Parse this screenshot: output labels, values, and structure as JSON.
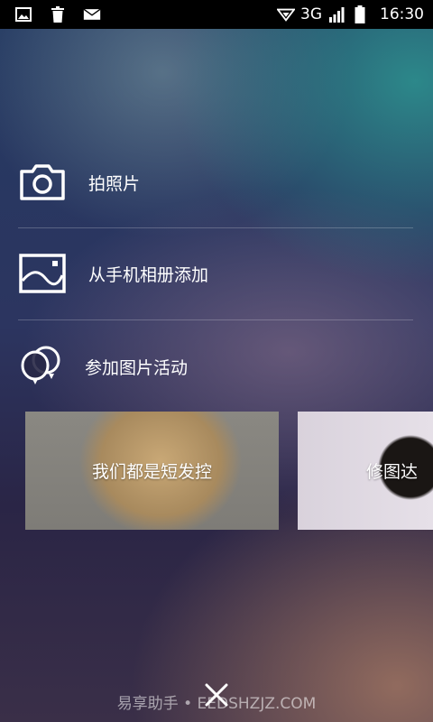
{
  "status_bar": {
    "network": "3G",
    "time": "16:30",
    "left_icons": [
      "image-icon",
      "trash-icon",
      "mail-icon"
    ],
    "right_icons": [
      "signal-hotspot-icon",
      "signal-bars-icon",
      "battery-icon"
    ]
  },
  "menu": {
    "items": [
      {
        "label": "拍照片",
        "icon": "camera-icon"
      },
      {
        "label": "从手机相册添加",
        "icon": "gallery-icon"
      },
      {
        "label": "参加图片活动",
        "icon": "balloons-icon"
      }
    ]
  },
  "activities": {
    "cards": [
      {
        "title": "我们都是短发控"
      },
      {
        "title": "修图达"
      }
    ]
  },
  "watermark": "易享助手 • EEDSHZJZ.COM",
  "colors": {
    "status_bar_bg": "#000000",
    "text": "#ffffff"
  }
}
